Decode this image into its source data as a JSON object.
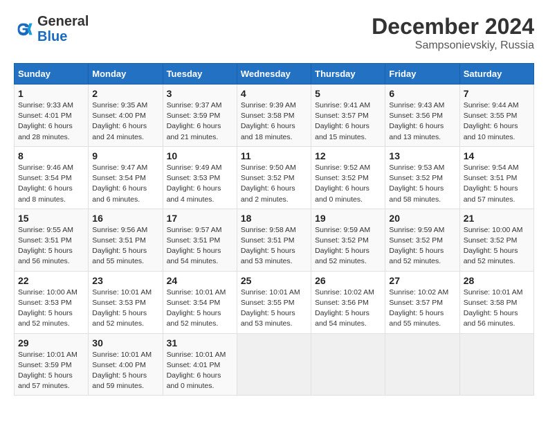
{
  "header": {
    "logo_line1": "General",
    "logo_line2": "Blue",
    "month": "December 2024",
    "location": "Sampsonievskiy, Russia"
  },
  "weekdays": [
    "Sunday",
    "Monday",
    "Tuesday",
    "Wednesday",
    "Thursday",
    "Friday",
    "Saturday"
  ],
  "weeks": [
    [
      {
        "day": "1",
        "info": "Sunrise: 9:33 AM\nSunset: 4:01 PM\nDaylight: 6 hours\nand 28 minutes."
      },
      {
        "day": "2",
        "info": "Sunrise: 9:35 AM\nSunset: 4:00 PM\nDaylight: 6 hours\nand 24 minutes."
      },
      {
        "day": "3",
        "info": "Sunrise: 9:37 AM\nSunset: 3:59 PM\nDaylight: 6 hours\nand 21 minutes."
      },
      {
        "day": "4",
        "info": "Sunrise: 9:39 AM\nSunset: 3:58 PM\nDaylight: 6 hours\nand 18 minutes."
      },
      {
        "day": "5",
        "info": "Sunrise: 9:41 AM\nSunset: 3:57 PM\nDaylight: 6 hours\nand 15 minutes."
      },
      {
        "day": "6",
        "info": "Sunrise: 9:43 AM\nSunset: 3:56 PM\nDaylight: 6 hours\nand 13 minutes."
      },
      {
        "day": "7",
        "info": "Sunrise: 9:44 AM\nSunset: 3:55 PM\nDaylight: 6 hours\nand 10 minutes."
      }
    ],
    [
      {
        "day": "8",
        "info": "Sunrise: 9:46 AM\nSunset: 3:54 PM\nDaylight: 6 hours\nand 8 minutes."
      },
      {
        "day": "9",
        "info": "Sunrise: 9:47 AM\nSunset: 3:54 PM\nDaylight: 6 hours\nand 6 minutes."
      },
      {
        "day": "10",
        "info": "Sunrise: 9:49 AM\nSunset: 3:53 PM\nDaylight: 6 hours\nand 4 minutes."
      },
      {
        "day": "11",
        "info": "Sunrise: 9:50 AM\nSunset: 3:52 PM\nDaylight: 6 hours\nand 2 minutes."
      },
      {
        "day": "12",
        "info": "Sunrise: 9:52 AM\nSunset: 3:52 PM\nDaylight: 6 hours\nand 0 minutes."
      },
      {
        "day": "13",
        "info": "Sunrise: 9:53 AM\nSunset: 3:52 PM\nDaylight: 5 hours\nand 58 minutes."
      },
      {
        "day": "14",
        "info": "Sunrise: 9:54 AM\nSunset: 3:51 PM\nDaylight: 5 hours\nand 57 minutes."
      }
    ],
    [
      {
        "day": "15",
        "info": "Sunrise: 9:55 AM\nSunset: 3:51 PM\nDaylight: 5 hours\nand 56 minutes."
      },
      {
        "day": "16",
        "info": "Sunrise: 9:56 AM\nSunset: 3:51 PM\nDaylight: 5 hours\nand 55 minutes."
      },
      {
        "day": "17",
        "info": "Sunrise: 9:57 AM\nSunset: 3:51 PM\nDaylight: 5 hours\nand 54 minutes."
      },
      {
        "day": "18",
        "info": "Sunrise: 9:58 AM\nSunset: 3:51 PM\nDaylight: 5 hours\nand 53 minutes."
      },
      {
        "day": "19",
        "info": "Sunrise: 9:59 AM\nSunset: 3:52 PM\nDaylight: 5 hours\nand 52 minutes."
      },
      {
        "day": "20",
        "info": "Sunrise: 9:59 AM\nSunset: 3:52 PM\nDaylight: 5 hours\nand 52 minutes."
      },
      {
        "day": "21",
        "info": "Sunrise: 10:00 AM\nSunset: 3:52 PM\nDaylight: 5 hours\nand 52 minutes."
      }
    ],
    [
      {
        "day": "22",
        "info": "Sunrise: 10:00 AM\nSunset: 3:53 PM\nDaylight: 5 hours\nand 52 minutes."
      },
      {
        "day": "23",
        "info": "Sunrise: 10:01 AM\nSunset: 3:53 PM\nDaylight: 5 hours\nand 52 minutes."
      },
      {
        "day": "24",
        "info": "Sunrise: 10:01 AM\nSunset: 3:54 PM\nDaylight: 5 hours\nand 52 minutes."
      },
      {
        "day": "25",
        "info": "Sunrise: 10:01 AM\nSunset: 3:55 PM\nDaylight: 5 hours\nand 53 minutes."
      },
      {
        "day": "26",
        "info": "Sunrise: 10:02 AM\nSunset: 3:56 PM\nDaylight: 5 hours\nand 54 minutes."
      },
      {
        "day": "27",
        "info": "Sunrise: 10:02 AM\nSunset: 3:57 PM\nDaylight: 5 hours\nand 55 minutes."
      },
      {
        "day": "28",
        "info": "Sunrise: 10:01 AM\nSunset: 3:58 PM\nDaylight: 5 hours\nand 56 minutes."
      }
    ],
    [
      {
        "day": "29",
        "info": "Sunrise: 10:01 AM\nSunset: 3:59 PM\nDaylight: 5 hours\nand 57 minutes."
      },
      {
        "day": "30",
        "info": "Sunrise: 10:01 AM\nSunset: 4:00 PM\nDaylight: 5 hours\nand 59 minutes."
      },
      {
        "day": "31",
        "info": "Sunrise: 10:01 AM\nSunset: 4:01 PM\nDaylight: 6 hours\nand 0 minutes."
      },
      null,
      null,
      null,
      null
    ]
  ]
}
